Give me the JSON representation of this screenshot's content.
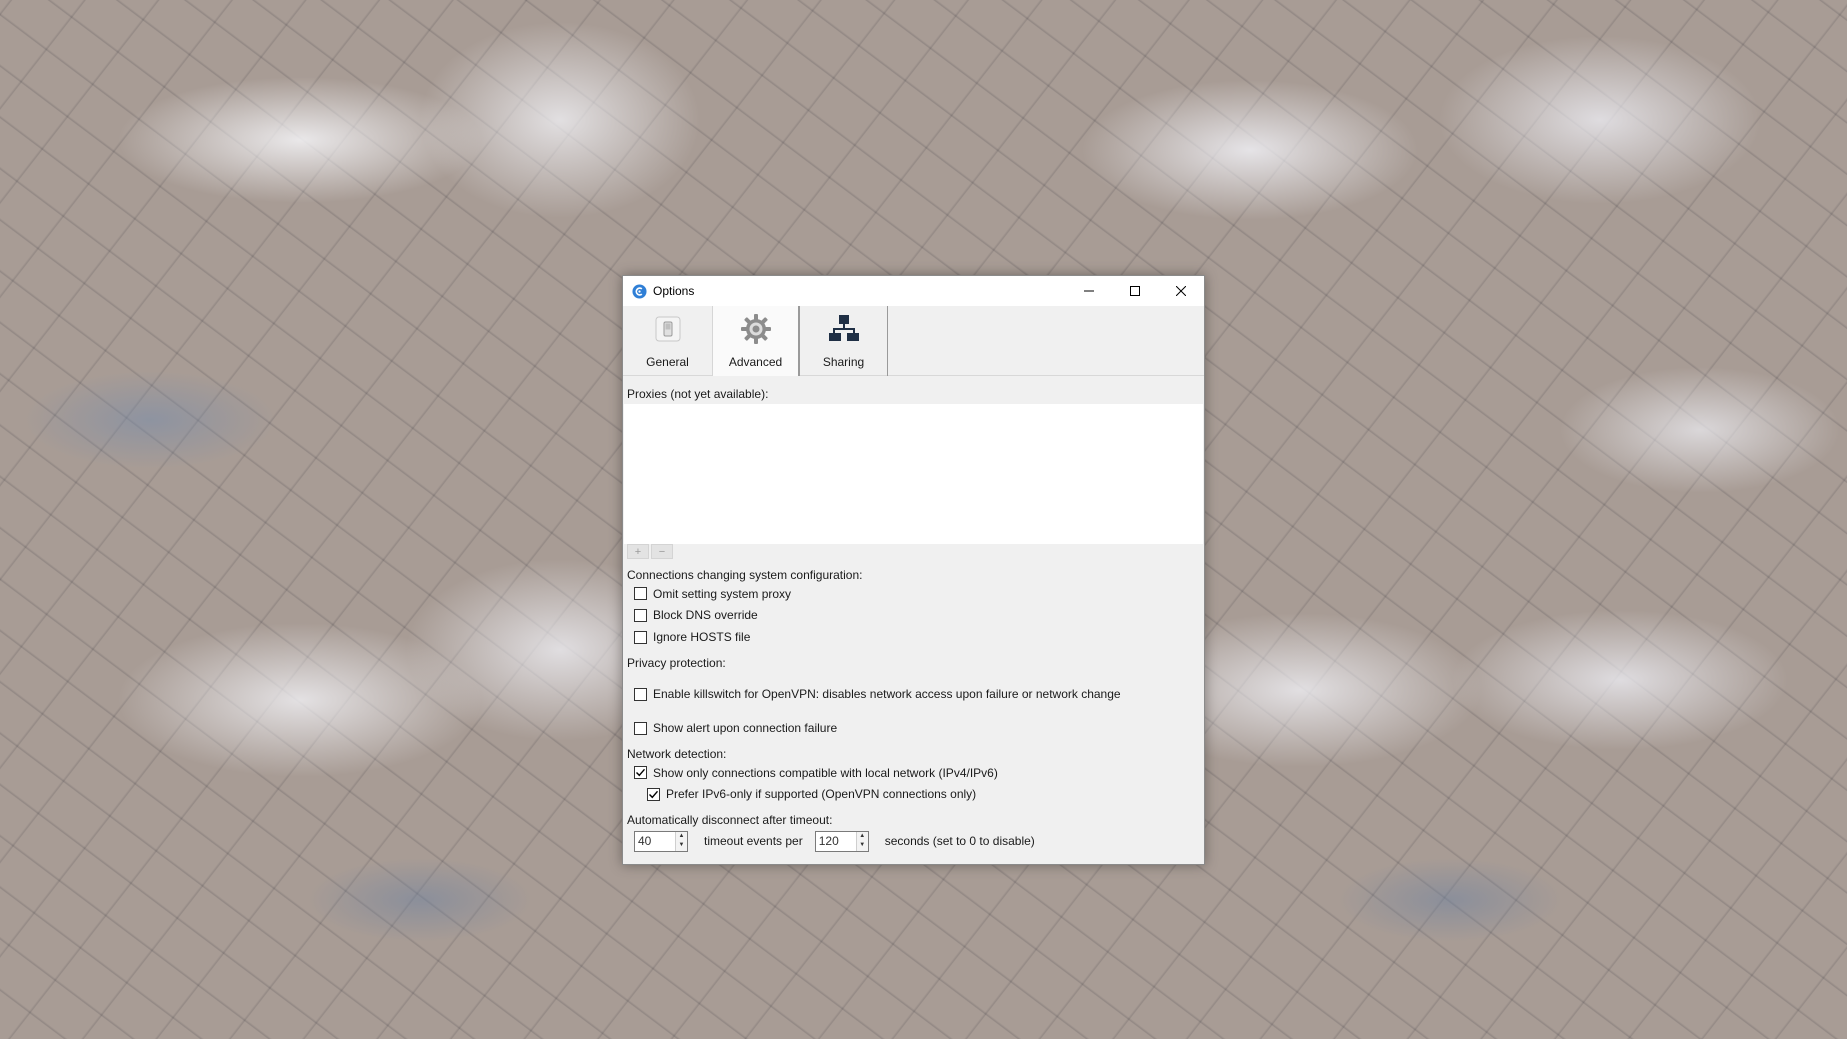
{
  "window": {
    "title": "Options",
    "controls": [
      "minimize",
      "maximize",
      "close"
    ]
  },
  "tabs": [
    {
      "label": "General",
      "icon": "switch-icon",
      "active": false
    },
    {
      "label": "Advanced",
      "icon": "gear-icon",
      "active": true
    },
    {
      "label": "Sharing",
      "icon": "network-icon",
      "active": false
    }
  ],
  "proxies": {
    "label": "Proxies (not yet available):",
    "add_button": "+",
    "remove_button": "−"
  },
  "system_config": {
    "label": "Connections changing system configuration:",
    "omit_proxy": {
      "label": "Omit setting system proxy",
      "checked": false
    },
    "block_dns": {
      "label": "Block DNS override",
      "checked": false
    },
    "ignore_hosts": {
      "label": "Ignore HOSTS file",
      "checked": false
    }
  },
  "privacy": {
    "label": "Privacy protection:",
    "killswitch": {
      "label": "Enable killswitch for OpenVPN: disables network access upon failure or network change",
      "checked": false
    },
    "alert": {
      "label": "Show alert upon connection failure",
      "checked": false
    }
  },
  "network": {
    "label": "Network detection:",
    "compatible_only": {
      "label": "Show only connections compatible with local network (IPv4/IPv6)",
      "checked": true
    },
    "prefer_ipv6": {
      "label": "Prefer IPv6-only if supported (OpenVPN connections only)",
      "checked": true
    }
  },
  "timeout": {
    "label": "Automatically disconnect after timeout:",
    "events_value": "40",
    "events_text": "timeout events per",
    "seconds_value": "120",
    "seconds_text": "seconds (set to 0 to disable)"
  },
  "colors": {
    "window_bg": "#f0f0f0",
    "titlebar_bg": "#ffffff",
    "app_icon": "#2f7fd6"
  }
}
